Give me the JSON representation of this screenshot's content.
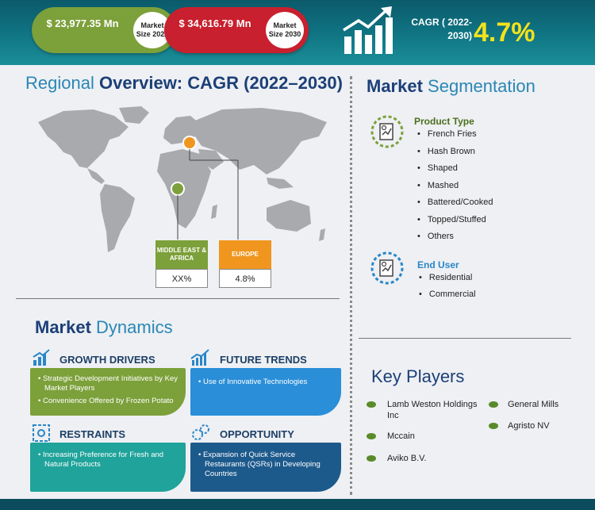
{
  "header": {
    "size_2022_value": "$ 23,977.35 Mn",
    "size_2022_label": "Market Size 2022",
    "size_2030_value": "$ 34,616.79 Mn",
    "size_2030_label": "Market Size 2030",
    "cagr_label": "CAGR ( 2022-2030)",
    "cagr_value": "4.7%",
    "colors": {
      "green": "#7ca03a",
      "red": "#c8202e",
      "cagr": "#f4e21b"
    }
  },
  "regional": {
    "title_bold_part": "Regional",
    "title_rest": "Overview: CAGR (2022–2030)",
    "regions": [
      {
        "name": "MIDDLE EAST & AFRICA",
        "value": "XX%",
        "color": "#7ca03a"
      },
      {
        "name": "EUROPE",
        "value": "4.8%",
        "color": "#f0961e"
      }
    ]
  },
  "segmentation": {
    "title_bold_part": "Market",
    "title_rest": "Segmentation",
    "product_type": {
      "heading": "Product Type",
      "items": [
        "French Fries",
        "Hash Brown",
        "Shaped",
        "Mashed",
        "Battered/Cooked",
        "Topped/Stuffed",
        "Others"
      ]
    },
    "end_user": {
      "heading": "End User",
      "items": [
        "Residential",
        "Commercial"
      ]
    }
  },
  "dynamics": {
    "title_bold_part": "Market",
    "title_rest": "Dynamics",
    "growth_drivers": {
      "heading": "GROWTH DRIVERS",
      "items": [
        "Strategic Development Initiatives by Key Market Players",
        "Convenience Offered by Frozen Potato"
      ]
    },
    "future_trends": {
      "heading": "FUTURE TRENDS",
      "items": [
        "Use of Innovative Technologies"
      ]
    },
    "restraints": {
      "heading": "RESTRAINTS",
      "items": [
        "Increasing Preference for Fresh and Natural Products"
      ]
    },
    "opportunity": {
      "heading": "OPPORTUNITY",
      "items": [
        "Expansion of Quick Service Restaurants (QSRs) in Developing Countries"
      ]
    }
  },
  "key_players": {
    "title": "Key Players",
    "left": [
      "Lamb Weston Holdings Inc",
      "Mccain",
      "Aviko B.V."
    ],
    "right": [
      "General Mills",
      "Agristo NV"
    ]
  }
}
